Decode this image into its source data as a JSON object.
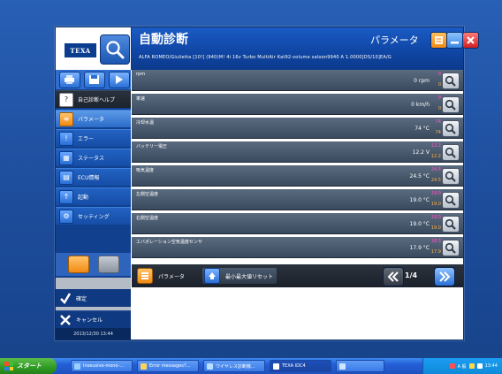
{
  "window": {
    "title": "自動診断",
    "subtitle": "ALFA ROMEO/Giulietta [10!] (940)M! 4i 16v Turbo MultiAir Kat92-volume saloon9940 A 1.0000[DS/10]EA/G",
    "mode_label": "パラメータ",
    "brand": "TEXA"
  },
  "sidebar": {
    "menu": [
      {
        "label": "自己診断ヘルプ",
        "icon": "help-magnifier-icon"
      },
      {
        "label": "パラメータ",
        "icon": "parameters-icon",
        "active": true
      },
      {
        "label": "エラー",
        "icon": "warning-icon"
      },
      {
        "label": "ステータス",
        "icon": "status-icon"
      },
      {
        "label": "ECU情報",
        "icon": "ecu-info-icon"
      },
      {
        "label": "起動",
        "icon": "activation-icon"
      },
      {
        "label": "セッティング",
        "icon": "settings-icon"
      }
    ],
    "confirm_label": "確定",
    "cancel_label": "キャンセル",
    "datetime": "2013/12/30 13:44"
  },
  "parameters": [
    {
      "name": "rpm",
      "value": "0 rpm",
      "max": "0",
      "min": "0"
    },
    {
      "name": "車速",
      "value": "0 km/h",
      "max": "0",
      "min": "0"
    },
    {
      "name": "冷却水温",
      "value": "74 °C",
      "max": "74",
      "min": "74"
    },
    {
      "name": "バッテリー電圧",
      "value": "12.2 V",
      "max": "12.2",
      "min": "12.2"
    },
    {
      "name": "吸気温度",
      "value": "24.5 °C",
      "max": "24.5",
      "min": "24.5"
    },
    {
      "name": "左側空温度",
      "value": "19.0 °C",
      "max": "19.0",
      "min": "19.0"
    },
    {
      "name": "右側空温度",
      "value": "19.0 °C",
      "max": "19.0",
      "min": "19.0"
    },
    {
      "name": "エバポレーション空気温度センサ",
      "value": "17.9 °C",
      "max": "18.3",
      "min": "17.9"
    }
  ],
  "bottom_bar": {
    "param_button": "パラメータ",
    "reset_button": "最小最大値リセット",
    "page_indicator": "1/4"
  },
  "taskbar": {
    "start_label": "スタート",
    "tasks": [
      "Inseusive-mono-...",
      "Error messages?...",
      "ワイヤレス診断機...",
      "TEXA IDC4",
      ""
    ],
    "clock": "13:44",
    "ime": "A 般"
  },
  "colors": {
    "accent_blue": "#1a5bc4",
    "max_color": "#ff58c0",
    "min_color": "#ffb048",
    "row_bg": "#4a5a70"
  }
}
